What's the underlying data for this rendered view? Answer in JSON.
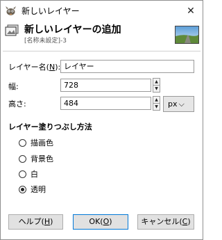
{
  "window": {
    "title": "新しいレイヤー",
    "close_glyph": "✕"
  },
  "header": {
    "title": "新しいレイヤーの追加",
    "subtitle": "[名称未設定]-3"
  },
  "form": {
    "layer_name": {
      "label": "レイヤー名(",
      "mnemonic": "N",
      "label_end": "):",
      "value": "レイヤー"
    },
    "width": {
      "label": "幅:",
      "value": "728"
    },
    "height": {
      "label": "高さ:",
      "value": "484"
    },
    "unit": {
      "value": "px",
      "arrow": "⌵"
    }
  },
  "fill": {
    "title": "レイヤー塗りつぶし方法",
    "options": [
      {
        "label": "描画色",
        "checked": false
      },
      {
        "label": "背景色",
        "checked": false
      },
      {
        "label": "白",
        "checked": false
      },
      {
        "label": "透明",
        "checked": true
      }
    ]
  },
  "buttons": {
    "help": {
      "label": "ヘルプ(",
      "mnemonic": "H",
      "end": ")"
    },
    "ok": {
      "label": "OK(",
      "mnemonic": "O",
      "end": ")"
    },
    "cancel": {
      "label": "キャンセル(",
      "mnemonic": "C",
      "end": ")"
    }
  },
  "spin_glyphs": {
    "up": "▲",
    "down": "▼"
  },
  "icons": {
    "app": "gimp-wilber-icon",
    "layer": "new-layer-icon",
    "preview": "image-preview-thumbnail"
  },
  "colors": {
    "ok_border": "#0078d7",
    "button_bg": "#e1e1e1"
  }
}
